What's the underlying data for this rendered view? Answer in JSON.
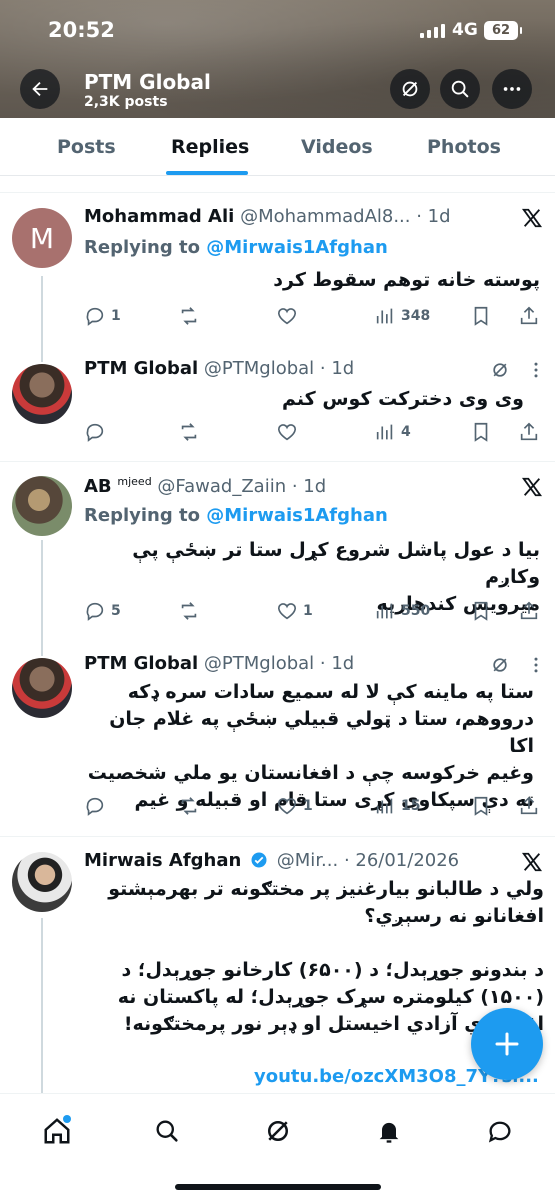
{
  "status_bar": {
    "time": "20:52",
    "network": "4G",
    "battery": "62"
  },
  "header": {
    "title": "PTM Global",
    "posts_count": "2,3K posts",
    "back_icon": "arrow-left-icon",
    "grok_icon": "grok-icon",
    "search_icon": "search-icon",
    "more_icon": "more-horizontal-icon"
  },
  "tabs": [
    {
      "label": "Posts",
      "active": false
    },
    {
      "label": "Replies",
      "active": true
    },
    {
      "label": "Videos",
      "active": false
    },
    {
      "label": "Photos",
      "active": false
    }
  ],
  "posts": [
    {
      "avatar_letter": "M",
      "name": "Mohammad Ali",
      "handle": "@MohammadAl8... · 1d",
      "replying_prefix": "Replying to ",
      "replying_to": "@Mirwais1Afghan",
      "text": "پوسته خانه توهم سقوط کرد",
      "replies": "1",
      "reposts": "",
      "likes": "",
      "views": "348"
    },
    {
      "name": "PTM Global",
      "handle": "@PTMglobal · 1d",
      "text": "وی وی دخترکت کوس کنم",
      "replies": "",
      "reposts": "",
      "likes": "",
      "views": "4"
    },
    {
      "name": "AB",
      "name_sup": "mjeed",
      "handle": "@Fawad_Zaiin · 1d",
      "replying_prefix": "Replying to ",
      "replying_to": "@Mirwais1Afghan",
      "text": "بیا د عول پاشل شروع کړل ستا تر ښځې پې وکاږم\nمیرویس کندهاریه",
      "replies": "5",
      "reposts": "",
      "likes": "1",
      "views": "550"
    },
    {
      "name": "PTM Global",
      "handle": "@PTMglobal · 1d",
      "text": "ستا په ماینه کې لا له سمیع سادات سره ډکه\nدرووهم، ستا د ټولي قبیلي ښځې په غلام جان اکا\nوغیم خرکوسه چې د افغانستان یو ملي شخصیت\nته دې سپکاوی کړی ستا قام او قبیله و غیم",
      "replies": "",
      "reposts": "",
      "likes": "1",
      "views": "15"
    },
    {
      "name": "Mirwais Afghan",
      "handle": "@Mir... · 26/01/2026",
      "text": "ولي د طالبانو بیارغنیز پر مختګونه تر بهرمېشتو\nافغانانو نه رسېږي؟\n\nد بندونو جوړېدل؛ د (۶۵۰۰) کارخانو جوړېدل؛ د\n(۱۵۰۰) کیلومتره سړک جوړېدل؛ له پاکستان نه\nاقتصادي آزادي اخیستل او ډېر نور پرمختګونه!",
      "link": "youtu.be/ozcXM3O8_7Y?si..."
    }
  ],
  "nav": [
    "home-icon",
    "search-icon",
    "grok-icon",
    "notifications-icon",
    "messages-icon"
  ],
  "colors": {
    "accent": "#1d9bf0",
    "text": "#0f1419",
    "muted": "#536471"
  }
}
